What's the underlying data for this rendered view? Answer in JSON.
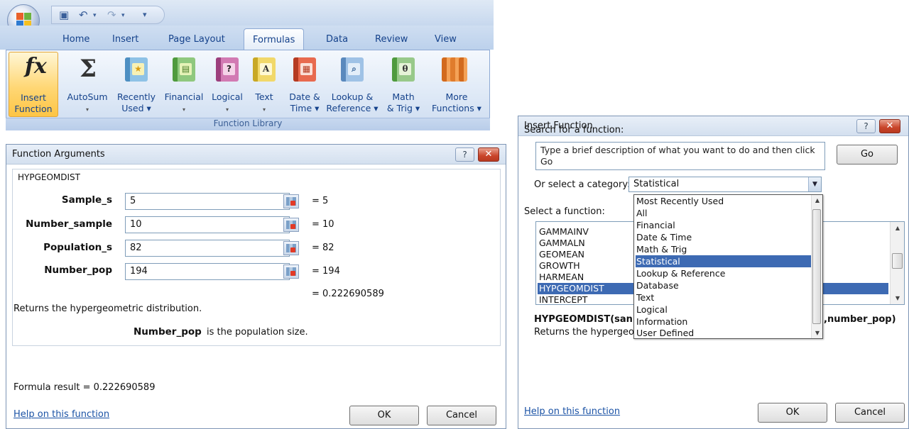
{
  "ribbon": {
    "tabs": [
      "Home",
      "Insert",
      "Page Layout",
      "Formulas",
      "Data",
      "Review",
      "View"
    ],
    "active_tab": "Formulas",
    "buttons": {
      "insert_function": [
        "Insert",
        "Function"
      ],
      "autosum": [
        "AutoSum"
      ],
      "recently_used": [
        "Recently",
        "Used ▾"
      ],
      "financial": [
        "Financial"
      ],
      "logical": [
        "Logical"
      ],
      "text": [
        "Text"
      ],
      "date_time": [
        "Date &",
        "Time ▾"
      ],
      "lookup_reference": [
        "Lookup &",
        "Reference ▾"
      ],
      "math_trig": [
        "Math",
        "& Trig ▾"
      ],
      "more_functions": [
        "More",
        "Functions ▾"
      ]
    },
    "group_label": "Function Library"
  },
  "function_arguments": {
    "title": "Function Arguments",
    "function_name": "HYPGEOMDIST",
    "args": [
      {
        "label": "Sample_s",
        "value": "5",
        "result": "= 5"
      },
      {
        "label": "Number_sample",
        "value": "10",
        "result": "= 10"
      },
      {
        "label": "Population_s",
        "value": "82",
        "result": "= 82"
      },
      {
        "label": "Number_pop",
        "value": "194",
        "result": "= 194"
      }
    ],
    "total_result": "= 0.222690589",
    "description": "Returns the hypergeometric distribution.",
    "arg_help_name": "Number_pop",
    "arg_help_text": "is the population size.",
    "formula_result": "Formula result =  0.222690589",
    "help_link": "Help on this function",
    "ok_label": "OK",
    "cancel_label": "Cancel",
    "help_icon": "?",
    "close_icon": "✕"
  },
  "insert_function": {
    "title": "Insert Function",
    "search_label": "Search for a function:",
    "search_text": "Type a brief description of what you want to do and then click Go",
    "go_label": "Go",
    "category_label": "Or select a category:",
    "category_value": "Statistical",
    "select_function_label": "Select a function:",
    "functions": [
      "GAMMAINV",
      "GAMMALN",
      "GEOMEAN",
      "GROWTH",
      "HARMEAN",
      "HYPGEOMDIST",
      "INTERCEPT"
    ],
    "selected_function": "HYPGEOMDIST",
    "categories": [
      "Most Recently Used",
      "All",
      "Financial",
      "Date & Time",
      "Math & Trig",
      "Statistical",
      "Lookup & Reference",
      "Database",
      "Text",
      "Logical",
      "Information",
      "User Defined"
    ],
    "selected_category": "Statistical",
    "signature_left": "HYPGEOMDIST(san",
    "signature_right": ",number_pop)",
    "description_partial": "Returns the hypergeo",
    "help_link": "Help on this function",
    "ok_label": "OK",
    "cancel_label": "Cancel",
    "help_icon": "?",
    "close_icon": "✕"
  }
}
